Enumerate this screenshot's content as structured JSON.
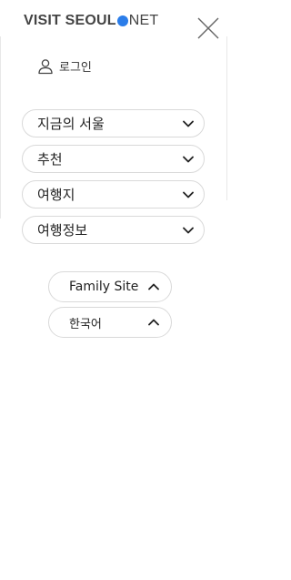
{
  "header": {
    "logo_part1": "VISIT SEOUL",
    "logo_part2": "NET",
    "close_icon": "close-icon",
    "brand_color": "#2b7de9"
  },
  "account": {
    "login_label": "로그인",
    "login_icon": "user-icon"
  },
  "menu": {
    "items": [
      {
        "label": "지금의 서울",
        "icon": "chevron-down-icon"
      },
      {
        "label": "추천",
        "icon": "chevron-down-icon"
      },
      {
        "label": "여행지",
        "icon": "chevron-down-icon"
      },
      {
        "label": "여행정보",
        "icon": "chevron-down-icon"
      }
    ]
  },
  "footer": {
    "family_site_label": "Family Site",
    "language_label": "한국어",
    "toggle_icon": "chevron-up-icon"
  }
}
